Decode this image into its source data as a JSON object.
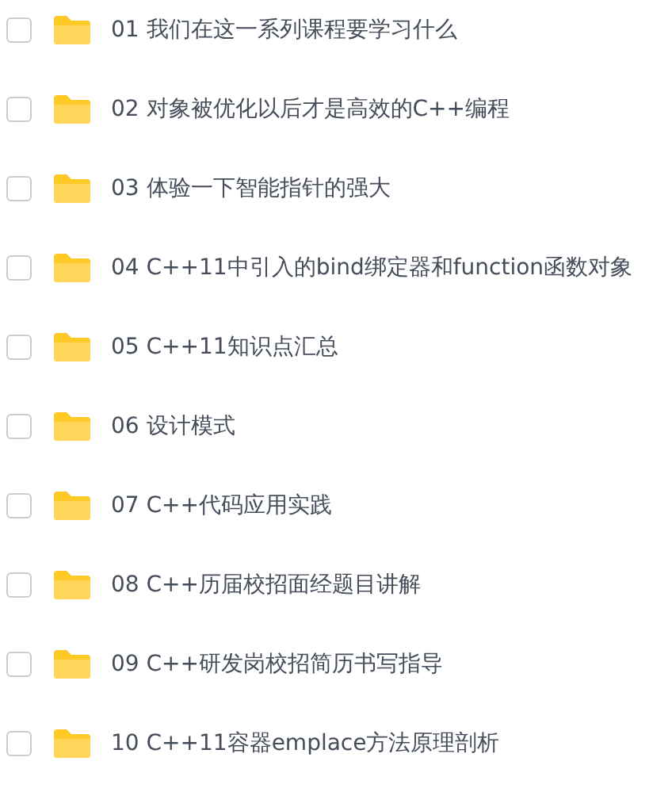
{
  "files": [
    {
      "name": "01 我们在这一系列课程要学习什么",
      "checked": false
    },
    {
      "name": "02 对象被优化以后才是高效的C++编程",
      "checked": false
    },
    {
      "name": "03 体验一下智能指针的强大",
      "checked": false
    },
    {
      "name": "04 C++11中引入的bind绑定器和function函数对象",
      "checked": false
    },
    {
      "name": "05 C++11知识点汇总",
      "checked": false
    },
    {
      "name": "06 设计模式",
      "checked": false
    },
    {
      "name": "07 C++代码应用实践",
      "checked": false
    },
    {
      "name": "08 C++历届校招面经题目讲解",
      "checked": false
    },
    {
      "name": "09 C++研发岗校招简历书写指导",
      "checked": false
    },
    {
      "name": "10 C++11容器emplace方法原理剖析",
      "checked": false
    }
  ]
}
